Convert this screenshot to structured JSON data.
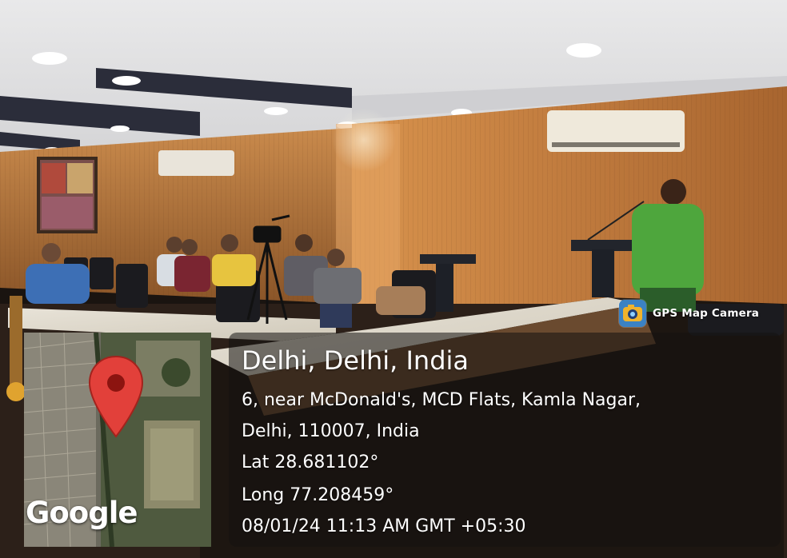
{
  "badge": {
    "label": "GPS Map Camera",
    "icon": "gps-map-camera-icon"
  },
  "map": {
    "provider_logo": "Google",
    "pin_icon": "map-pin-icon"
  },
  "location": {
    "title": "Delhi, Delhi, India",
    "address_line1": "6, near McDonald's, MCD Flats, Kamla Nagar,",
    "address_line2": "Delhi, 110007, India",
    "latitude": "Lat 28.681102°",
    "longitude": "Long 77.208459°",
    "timestamp": "08/01/24 11:13 AM GMT +05:30"
  },
  "colors": {
    "pin": "#e2403a",
    "badge_bg": "#3b82c4"
  }
}
